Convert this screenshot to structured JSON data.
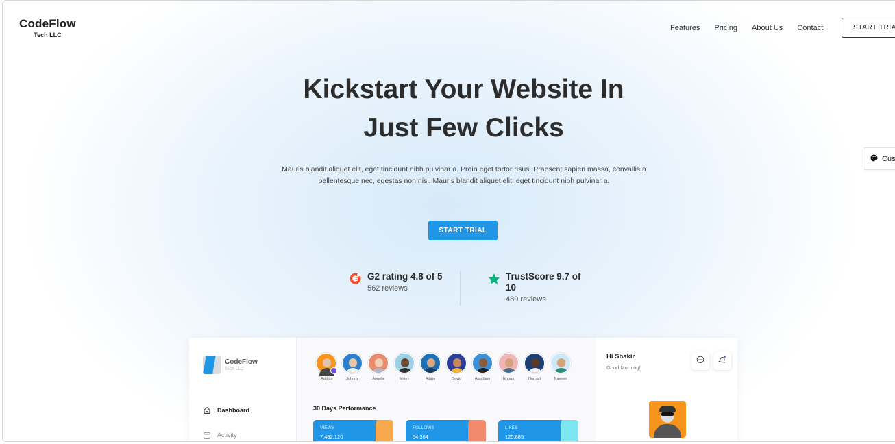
{
  "header": {
    "logo_name": "CodeFlow",
    "logo_sub": "Tech LLC",
    "nav": [
      "Features",
      "Pricing",
      "About Us",
      "Contact"
    ],
    "cta_label": "START TRIAL"
  },
  "hero": {
    "title_line1": "Kickstart Your Website In",
    "title_line2": "Just Few Clicks",
    "description": "Mauris blandit aliquet elit, eget tincidunt nibh pulvinar a. Proin eget tortor risus. Praesent sapien massa, convallis a pellentesque nec, egestas non nisi. Mauris blandit aliquet elit, eget tincidunt nibh pulvinar a.",
    "cta_label": "START TRIAL"
  },
  "ratings": [
    {
      "title": "G2 rating 4.8 of 5",
      "sub": "562 reviews",
      "icon": "g2-icon",
      "color": "#ff492c"
    },
    {
      "title": "TrustScore 9.7 of 10",
      "sub": "489 reviews",
      "icon": "star-icon",
      "color": "#00b67a"
    }
  ],
  "side_tab": {
    "label": "Cus",
    "icon": "palette-icon"
  },
  "dashboard": {
    "logo_name": "CodeFlow",
    "logo_sub": "Tech LLC",
    "menu": [
      {
        "label": "Dashboard",
        "icon": "home-icon"
      },
      {
        "label": "Activity",
        "icon": "calendar-icon"
      }
    ],
    "avatars": [
      "Add to",
      "Johnny",
      "Angela",
      "Mikey",
      "Adam",
      "David",
      "Abraham",
      "Iknous",
      "Nomad",
      "Naveen"
    ],
    "performance_title": "30 Days Performance",
    "cards": [
      {
        "label": "VIEWS",
        "value": "7,482,120",
        "accent": "#f7a94b"
      },
      {
        "label": "FOLLOWS",
        "value": "54,364",
        "accent": "#f08a6a"
      },
      {
        "label": "LIKES",
        "value": "125,685",
        "accent": "#7ee6f0"
      }
    ],
    "greeting": "Hi Shakir",
    "greeting_sub": "Good Morning!"
  },
  "colors": {
    "brand_blue": "#2196e6",
    "text_dark": "#2c2c2c"
  }
}
